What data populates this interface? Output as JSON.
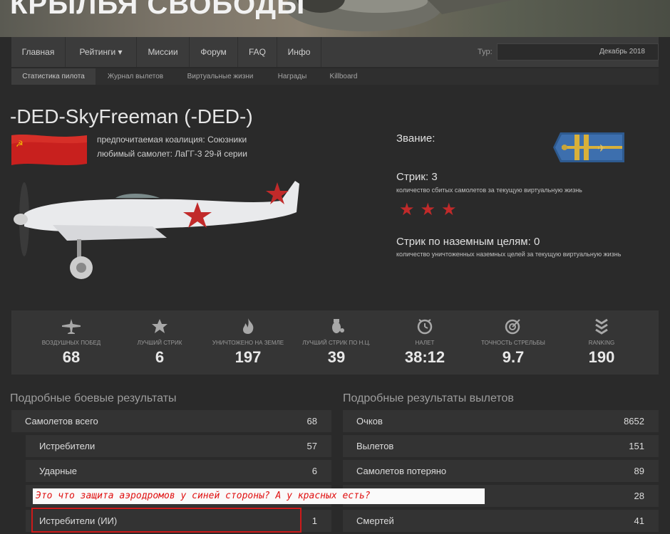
{
  "banner": {
    "title": "КРЫЛЬЯ СВОБОДЫ"
  },
  "nav": {
    "items": [
      "Главная",
      "Рейтинги ▾",
      "Миссии",
      "Форум",
      "FAQ",
      "Инфо"
    ],
    "tour_label": "Тур:",
    "tour_value": "Декабрь 2018"
  },
  "subnav": {
    "items": [
      "Статистика пилота",
      "Журнал вылетов",
      "Виртуальные жизни",
      "Награды",
      "Killboard"
    ],
    "active": 0
  },
  "pilot": {
    "name": "-DED-SkyFreeman (-DED-)",
    "coalition": "предпочитаемая коалиция: Союзники",
    "favorite_plane": "любимый самолет: ЛаГГ-3 29-й серии"
  },
  "rank": {
    "label": "Звание:"
  },
  "streak": {
    "title": "Стрик: 3",
    "subtitle": "количество сбитых самолетов за текущую виртуальную жизнь",
    "stars": "★★★"
  },
  "ground_streak": {
    "title": "Стрик по наземным целям: 0",
    "subtitle": "количество уничтоженных наземных целей за текущую виртуальную жизнь"
  },
  "stats": [
    {
      "label": "Воздушных побед",
      "value": "68",
      "icon": "plane-icon"
    },
    {
      "label": "Лучший стрик",
      "value": "6",
      "icon": "star-icon"
    },
    {
      "label": "Уничтожено на земле",
      "value": "197",
      "icon": "fire-icon"
    },
    {
      "label": "Лучший стрик по Н.Ц.",
      "value": "39",
      "icon": "bomb-icon"
    },
    {
      "label": "Налет",
      "value": "38:12",
      "icon": "clock-icon"
    },
    {
      "label": "Точность стрельбы",
      "value": "9.7",
      "icon": "target-icon"
    },
    {
      "label": "Ranking",
      "value": "190",
      "icon": "chevrons-icon"
    }
  ],
  "combat": {
    "title": "Подробные боевые результаты",
    "rows": [
      {
        "label": "Самолетов всего",
        "value": "68"
      },
      {
        "label": "Истребители",
        "value": "57"
      },
      {
        "label": "Ударные",
        "value": "6"
      },
      {
        "label": "",
        "value": ""
      },
      {
        "label": "Истребители (ИИ)",
        "value": "1"
      }
    ]
  },
  "sorties": {
    "title": "Подробные результаты вылетов",
    "rows": [
      {
        "label": "Очков",
        "value": "8652"
      },
      {
        "label": "Вылетов",
        "value": "151"
      },
      {
        "label": "Самолетов потеряно",
        "value": "89"
      },
      {
        "label": "",
        "value": "28"
      },
      {
        "label": "Смертей",
        "value": "41"
      }
    ]
  },
  "annotation": {
    "text": "Это что защита аэродромов у синей стороны? А у красных есть?"
  },
  "colors": {
    "accent_red": "#c12a2a",
    "annotation_red": "#e01010",
    "panel": "#333333"
  }
}
